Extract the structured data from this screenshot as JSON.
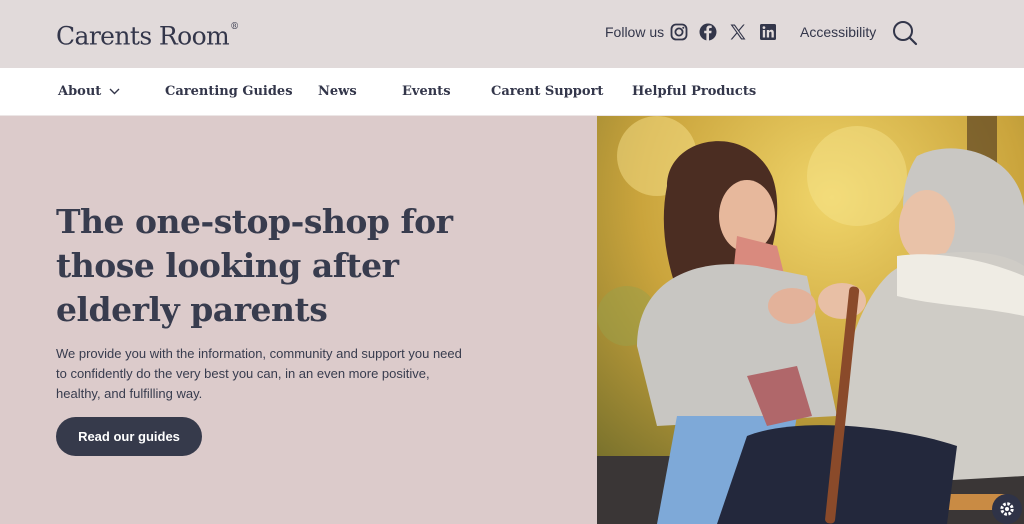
{
  "brand": {
    "name": "Carents Room",
    "mark": "®"
  },
  "header": {
    "follow_label": "Follow us",
    "social": [
      "instagram-icon",
      "facebook-icon",
      "x-icon",
      "linkedin-icon"
    ],
    "accessibility_label": "Accessibility",
    "search_icon": "search-icon"
  },
  "nav": {
    "items": [
      {
        "label": "About",
        "has_dropdown": true
      },
      {
        "label": "Carenting Guides"
      },
      {
        "label": "News"
      },
      {
        "label": "Events"
      },
      {
        "label": "Carent Support"
      },
      {
        "label": "Helpful Products"
      }
    ]
  },
  "hero": {
    "title": "The one-stop-shop for those looking after elderly parents",
    "body": "We provide you with the information, community and support you need to confidently do the very best you can, in an even more positive, healthy, and fulfilling way.",
    "cta_label": "Read our guides"
  },
  "colors": {
    "topbar_bg": "#e1dada",
    "hero_bg": "#dccbcb",
    "text_dark": "#33364a",
    "button_bg": "#363a4b"
  }
}
